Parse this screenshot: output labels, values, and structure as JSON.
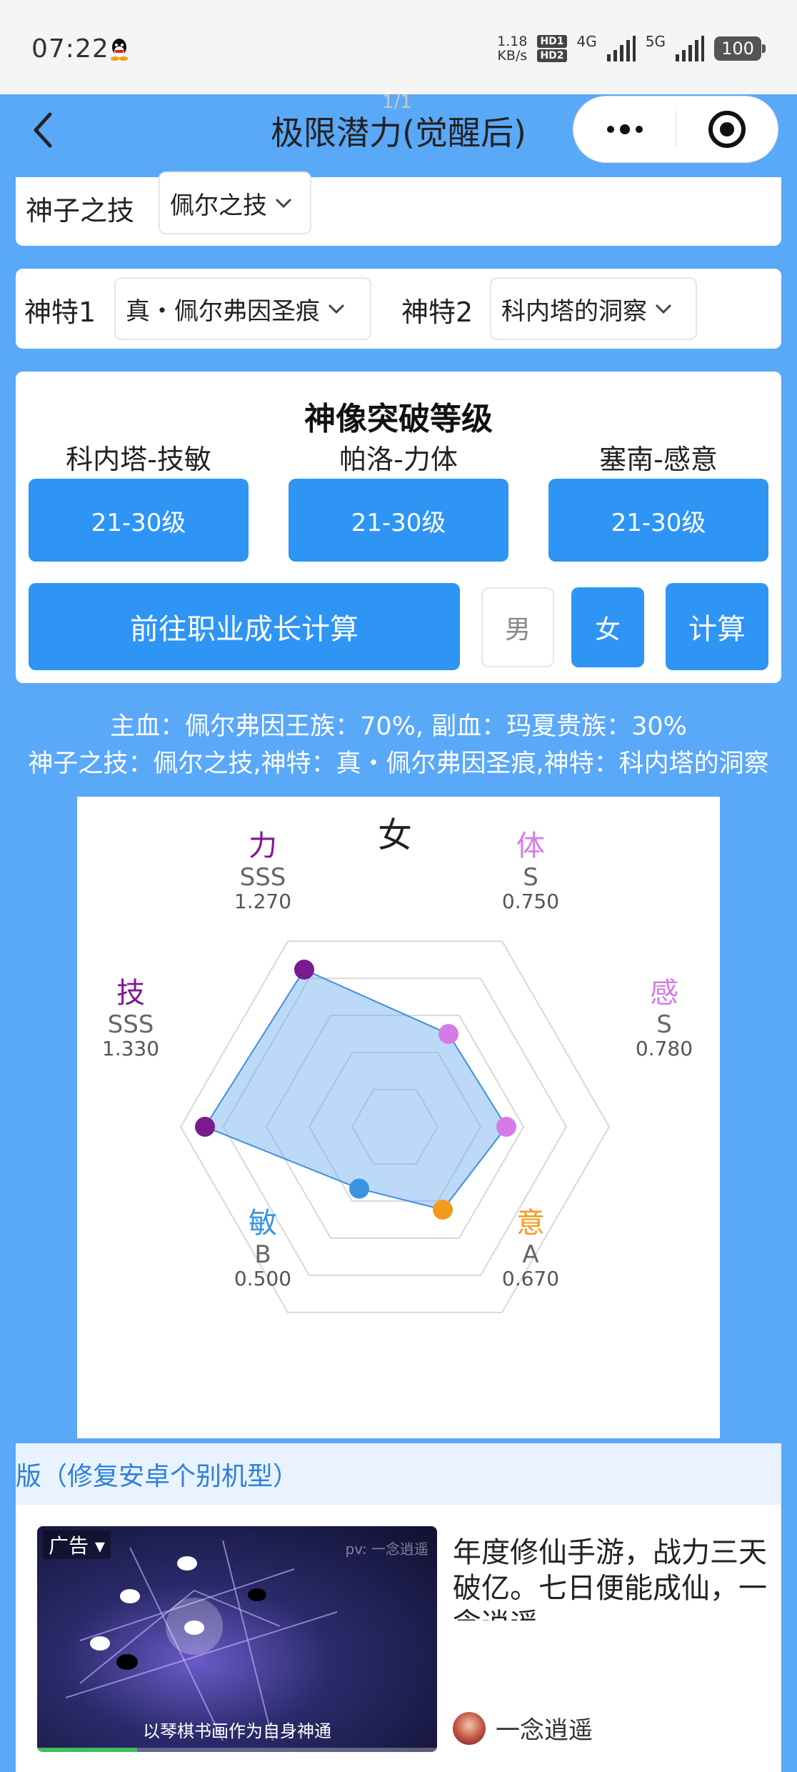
{
  "status_bar": {
    "time": "07:22",
    "net_speed_value": "1.18",
    "net_speed_unit": "KB/s",
    "hd1": "HD1",
    "hd2": "HD2",
    "signal1": "4G",
    "signal2": "5G",
    "battery": "100"
  },
  "title_bar": {
    "title": "极限潜力(觉醒后)",
    "page_counter": "1/1"
  },
  "skill_row": {
    "label": "神子之技",
    "value": "佩尔之技"
  },
  "trait_row": {
    "trait1_label": "神特1",
    "trait1_value": "真・佩尔弗因圣痕",
    "trait2_label": "神特2",
    "trait2_value": "科内塔的洞察"
  },
  "breakthrough": {
    "title": "神像突破等级",
    "items": [
      {
        "label": "科内塔-技敏",
        "value": "21-30级"
      },
      {
        "label": "帕洛-力体",
        "value": "21-30级"
      },
      {
        "label": "塞南-感意",
        "value": "21-30级"
      }
    ],
    "career_button": "前往职业成长计算",
    "male": "男",
    "female": "女",
    "selected_gender": "女",
    "calc_button": "计算"
  },
  "summary": {
    "line1": "主血：佩尔弗因王族：70%, 副血：玛夏贵族：30%",
    "line2": "神子之技：佩尔之技,神特：真・佩尔弗因圣痕,神特：科内塔的洞察"
  },
  "chart_data": {
    "type": "radar",
    "title": "女",
    "axes": [
      {
        "name": "力",
        "grade": "SSS",
        "value": 1.27,
        "display": "1.270",
        "color": "#7b1a8c"
      },
      {
        "name": "体",
        "grade": "S",
        "value": 0.75,
        "display": "0.750",
        "color": "#d57be8"
      },
      {
        "name": "感",
        "grade": "S",
        "value": 0.78,
        "display": "0.780",
        "color": "#d57be8"
      },
      {
        "name": "意",
        "grade": "A",
        "value": 0.67,
        "display": "0.670",
        "color": "#f39a1e"
      },
      {
        "name": "敏",
        "grade": "B",
        "value": 0.5,
        "display": "0.500",
        "color": "#3a95e0"
      },
      {
        "name": "技",
        "grade": "SSS",
        "value": 1.33,
        "display": "1.330",
        "color": "#7b1a8c"
      }
    ],
    "grid_levels": 5,
    "fill_color": "#6aaaf0"
  },
  "notice": {
    "text": "版（修复安卓个别机型）"
  },
  "ad": {
    "tag": "广告",
    "watermark": "pv: 一念逍遥",
    "caption": "以琴棋书画作为自身神通",
    "headline": "年度修仙手游，战力三天破亿。七日便能成仙，一念逍遥",
    "author": "一念逍遥",
    "progress": 0.25
  }
}
